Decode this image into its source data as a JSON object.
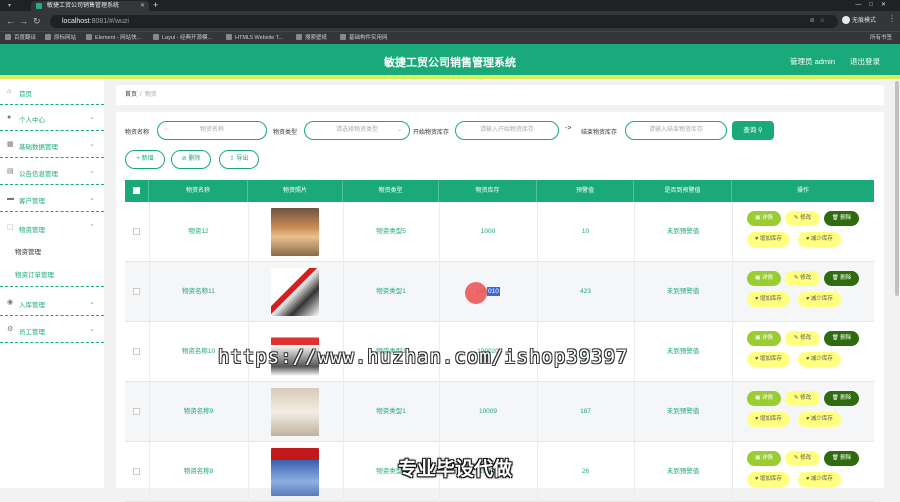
{
  "browser": {
    "tab_title": "敏捷工贸公司销售管理系统",
    "url_host": "localhost",
    "url_path": ":8081/#/wuzi",
    "profile_label": "无痕模式",
    "bookmarks": [
      "百度翻译",
      "原标网站",
      "Element - 网站快...",
      "Layui - 经典开源模...",
      "HTML5 Website T...",
      "搜索壁纸",
      "基础构件实用网"
    ],
    "bookmarks_right": "所有书签"
  },
  "header": {
    "title": "敏捷工贸公司销售管理系统",
    "admin_label": "管理员 admin",
    "logout_label": "退出登录"
  },
  "sidebar": {
    "items": [
      {
        "label": "首页",
        "icon": "home-icon"
      },
      {
        "label": "个人中心",
        "icon": "user-icon"
      },
      {
        "label": "基础数据管理",
        "icon": "grid-icon"
      },
      {
        "label": "公告信息管理",
        "icon": "notice-icon"
      },
      {
        "label": "客户管理",
        "icon": "customer-icon"
      },
      {
        "label": "物资管理",
        "icon": "box-icon"
      }
    ],
    "sub_items": [
      "物资管理",
      "物资订单管理"
    ],
    "bottom_items": [
      {
        "label": "入库管理",
        "icon": "location-icon"
      },
      {
        "label": "员工管理",
        "icon": "staff-icon"
      }
    ]
  },
  "breadcrumb": {
    "home": "首页",
    "separator": "/",
    "current": "物资"
  },
  "filters": {
    "name_label": "物资名称",
    "name_placeholder": "物资名称",
    "type_label": "物资类型",
    "type_placeholder": "请选择物资类型",
    "start_label": "开始物资库存",
    "start_placeholder": "请输入开始物资库存",
    "arrow": "->",
    "end_label": "结束物资库存",
    "end_placeholder": "请输入结束物资库存",
    "search_button": "查询"
  },
  "actions": {
    "add": "新增",
    "delete": "删除",
    "export": "导出"
  },
  "table": {
    "headers": [
      "物资名称",
      "物资照片",
      "物资类型",
      "物资库存",
      "预警值",
      "是否到预警值",
      "操作"
    ],
    "rows": [
      {
        "name": "物资12",
        "type": "物资类型5",
        "stock": "1000",
        "warn": "10",
        "reached": "未到预警值",
        "photo": "dog-photo"
      },
      {
        "name": "物资名称11",
        "type": "物资类型1",
        "stock": "100010",
        "warn": "423",
        "reached": "未到预警值",
        "photo": "ebike-photo"
      },
      {
        "name": "物资名称10",
        "type": "物资类型1",
        "stock": "100020",
        "warn": "153",
        "reached": "未到预警值",
        "photo": "scooter-photo"
      },
      {
        "name": "物资名称9",
        "type": "物资类型1",
        "stock": "10009",
        "warn": "187",
        "reached": "未到预警值",
        "photo": "pet-photo"
      },
      {
        "name": "物资名称8",
        "type": "物资类型1",
        "stock": "10009",
        "warn": "26",
        "reached": "未到预警值",
        "photo": "dogbed-photo"
      }
    ],
    "row_buttons": {
      "detail": "详情",
      "edit": "修改",
      "delete": "删除",
      "add_stock": "增加库存",
      "reduce_stock": "减少库存"
    }
  },
  "watermarks": {
    "url": "https://www.huzhan.com/ishop39397",
    "text": "专业毕设代做"
  },
  "colors": {
    "primary": "#1aa97a",
    "accent_yellow": "#d8ee5b",
    "detail": "#9acd32",
    "delete": "#2f6b0f",
    "edit": "#ffff80"
  }
}
